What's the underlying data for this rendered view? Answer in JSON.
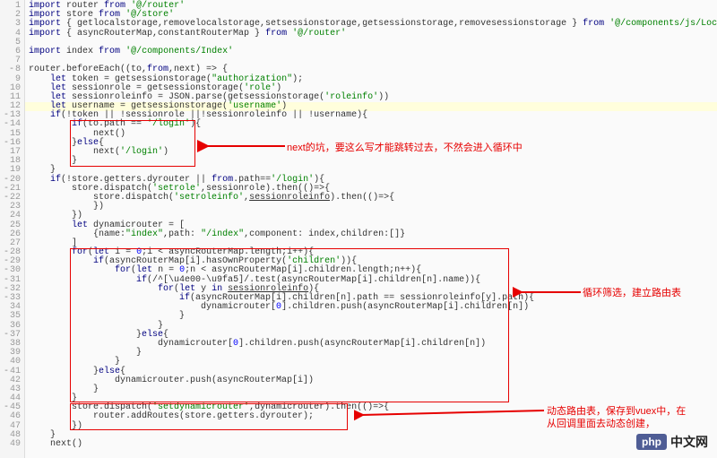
{
  "gutter": [
    "1",
    "2",
    "3",
    "4",
    "5",
    "6",
    "7",
    "8",
    "9",
    "10",
    "11",
    "12",
    "13",
    "14",
    "15",
    "16",
    "17",
    "18",
    "19",
    "20",
    "21",
    "22",
    "23",
    "24",
    "25",
    "26",
    "27",
    "28",
    "29",
    "30",
    "31",
    "32",
    "33",
    "34",
    "35",
    "36",
    "37",
    "38",
    "39",
    "40",
    "41",
    "42",
    "43",
    "44",
    "45",
    "46",
    "47",
    "48",
    "49"
  ],
  "code": {
    "l1": "import router from '@/router'",
    "l2": "import store from '@/store'",
    "l3": "import { getlocalstorage,removelocalstorage,setsessionstorage,getsessionstorage,removesessionstorage } from '@/components/js/Localstorage'",
    "l4": "import { asyncRouterMap,constantRouterMap } from '@/router'",
    "l6": "import index from '@/components/Index'",
    "l8": "router.beforeEach((to,from,next) => {",
    "l9": "    let token = getsessionstorage(\"authorization\");",
    "l10": "    let sessionrole = getsessionstorage('role')",
    "l11": "    let sessionroleinfo = JSON.parse(getsessionstorage('roleinfo'))",
    "l12": "    let username = getsessionstorage('username')",
    "l13": "    if(!token || !sessionrole ||!sessionroleinfo || !username){",
    "l14": "        if(to.path == '/login'){",
    "l15": "            next()",
    "l16": "        }else{",
    "l17": "            next('/login')",
    "l18": "        }",
    "l19": "    }",
    "l20": "    if(!store.getters.dyrouter || from.path=='/login'){",
    "l21": "        store.dispatch('setrole',sessionrole).then(()=>{",
    "l22": "            store.dispatch('setroleinfo',sessionroleinfo).then(()=>{",
    "l23": "            })",
    "l24": "        })",
    "l25": "        let dynamicrouter = [",
    "l26": "            {name:\"index\",path: \"/index\",component: index,children:[]}",
    "l27": "        ]",
    "l28": "        for(let i = 0;i < asyncRouterMap.length;i++){",
    "l29": "            if(asyncRouterMap[i].hasOwnProperty('children')){",
    "l30": "                for(let n = 0;n < asyncRouterMap[i].children.length;n++){",
    "l31": "                    if(/^[\\u4e00-\\u9fa5]/.test(asyncRouterMap[i].children[n].name)){",
    "l32": "                        for(let y in sessionroleinfo){",
    "l33": "                            if(asyncRouterMap[i].children[n].path == sessionroleinfo[y].path){",
    "l34": "                                dynamicrouter[0].children.push(asyncRouterMap[i].children[n])",
    "l35": "                            }",
    "l36": "                        }",
    "l37": "                    }else{",
    "l38": "                        dynamicrouter[0].children.push(asyncRouterMap[i].children[n])",
    "l39": "                    }",
    "l40": "                }",
    "l41": "            }else{",
    "l42": "                dynamicrouter.push(asyncRouterMap[i])",
    "l43": "            }",
    "l44": "        }",
    "l45": "        store.dispatch('setdynamicrouter',dynamicrouter).then(()=>{",
    "l46": "            router.addRoutes(store.getters.dyrouter);",
    "l47": "        })",
    "l48": "    }",
    "l49": "    next()"
  },
  "annotations": {
    "a1": "next的坑，要这么写才能跳转过去，不然会进入循环中",
    "a2": "循环筛选，建立路由表",
    "a3": "动态路由表，保存到vuex中，在\n从回调里面去动态创建，"
  },
  "watermark": {
    "logo": "php",
    "text": "中文网"
  }
}
